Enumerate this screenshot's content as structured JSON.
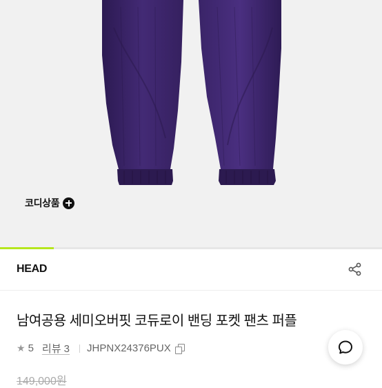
{
  "product_image": {
    "coordi_label": "코디상품",
    "gallery_progress": 0.14,
    "colors": {
      "background": "#f1f1f1",
      "pants": "#3a2465",
      "accent": "#b5e61d"
    }
  },
  "brand": {
    "name": "HEAD",
    "share_icon": "share-icon"
  },
  "product": {
    "title": "남여공용 세미오버핏 코듀로이 밴딩 포켓 팬츠 퍼플",
    "rating": "5",
    "review_label": "리뷰",
    "review_count": "3",
    "review_text": "리뷰 3",
    "sku": "JHPNX24376PUX",
    "price": "149,000원"
  },
  "floating": {
    "chat_icon": "chat-icon"
  }
}
